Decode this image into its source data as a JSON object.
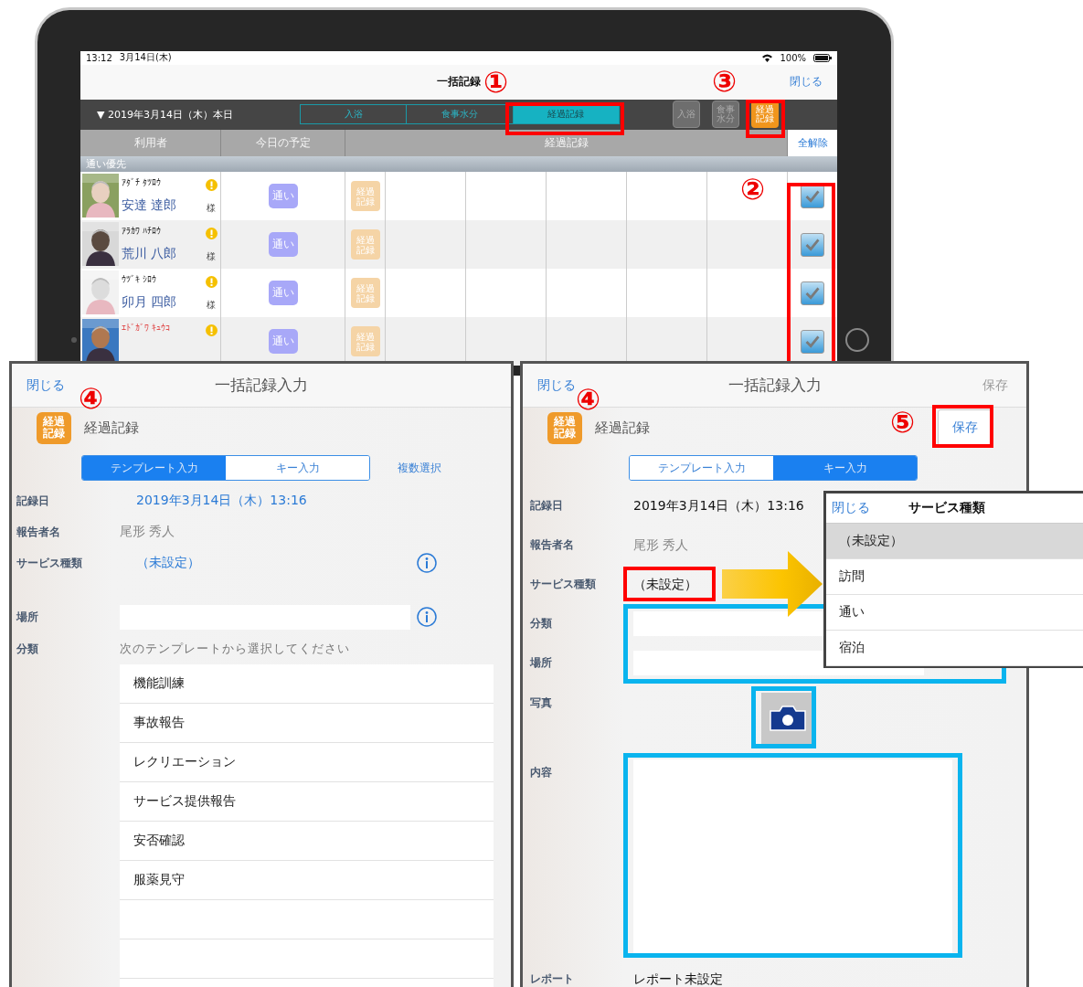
{
  "tablet": {
    "status_bar": {
      "time": "13:12",
      "date": "3月14日(木)",
      "battery": "100%"
    },
    "title": "一括記録",
    "close": "閉じる",
    "date_selector": "▼ 2019年3月14日（木）本日",
    "segments": [
      {
        "label": "入浴",
        "selected": false
      },
      {
        "label": "食事水分",
        "selected": false
      },
      {
        "label": "経過記録",
        "selected": true
      }
    ],
    "quick_buttons": [
      {
        "label": "入浴",
        "selected": false
      },
      {
        "label": "食事水分",
        "selected": false
      },
      {
        "label": "経過記録",
        "selected": true
      }
    ],
    "columns": [
      "利用者",
      "今日の予定",
      "経過記録"
    ],
    "clear_all": "全解除",
    "group": "通い優先",
    "rows": [
      {
        "kana": "ｱﾀﾞﾁ ﾀﾂﾛｳ",
        "name": "安達 達郎",
        "honorific": "様",
        "alert": true,
        "flagged": false,
        "schedule": "通い",
        "record": "経過記録",
        "checked": true
      },
      {
        "kana": "ｱﾗｶﾜ ﾊﾁﾛｳ",
        "name": "荒川 八郎",
        "honorific": "様",
        "alert": true,
        "flagged": false,
        "schedule": "通い",
        "record": "経過記録",
        "checked": true
      },
      {
        "kana": "ｳﾂﾞｷ ｼﾛｳ",
        "name": "卯月 四郎",
        "honorific": "様",
        "alert": true,
        "flagged": false,
        "schedule": "通い",
        "record": "経過記録",
        "checked": true
      },
      {
        "kana": "ｴﾄﾞｶﾞﾜ ｷｭｳｺ",
        "alert": true,
        "flagged": true,
        "schedule": "通い",
        "record": "経過記録",
        "checked": true
      }
    ]
  },
  "left_panel": {
    "close": "閉じる",
    "title": "一括記録入力",
    "section_icon": "経過記録",
    "section": "経過記録",
    "mode_tabs": [
      {
        "label": "テンプレート入力",
        "selected": true
      },
      {
        "label": "キー入力",
        "selected": false
      }
    ],
    "multi_select": "複数選択",
    "fields": [
      {
        "kind": "value",
        "label": "記録日",
        "value": "2019年3月14日（木）13:16",
        "accent": true
      },
      {
        "kind": "readonly",
        "label": "報告者名",
        "value": "尾形 秀人"
      },
      {
        "kind": "value",
        "label": "サービス種類",
        "value": "（未設定）",
        "accent": true,
        "info": true
      },
      {
        "kind": "input",
        "label": "場所",
        "info": true
      },
      {
        "kind": "hint",
        "label": "分類",
        "value": "次のテンプレートから選択してください"
      }
    ],
    "templates": [
      "機能訓練",
      "事故報告",
      "レクリエーション",
      "サービス提供報告",
      "安否確認",
      "服薬見守"
    ]
  },
  "right_panel": {
    "close": "閉じる",
    "title": "一括記録入力",
    "save_top": {
      "label": "保存",
      "disabled": true
    },
    "section_icon": "経過記録",
    "section": "経過記録",
    "save": "保存",
    "mode_tabs": [
      {
        "label": "テンプレート入力",
        "selected": false
      },
      {
        "label": "キー入力",
        "selected": true
      }
    ],
    "fields": [
      {
        "kind": "value",
        "label": "記録日",
        "value": "2019年3月14日（木）13:16",
        "accent": false
      },
      {
        "kind": "readonly",
        "label": "報告者名",
        "value": "尾形 秀人"
      },
      {
        "kind": "value",
        "label": "サービス種類",
        "value": "（未設定）",
        "accent": false
      },
      {
        "kind": "input",
        "label": "分類"
      },
      {
        "kind": "input",
        "label": "場所"
      },
      {
        "label": "写真"
      },
      {
        "kind": "textarea",
        "label": "内容"
      },
      {
        "kind": "value",
        "label": "レポート",
        "value": "レポート未設定",
        "accent": false
      }
    ]
  },
  "service_popup": {
    "close": "閉じる",
    "title": "サービス種類",
    "options": [
      {
        "label": "（未設定）",
        "selected": true
      },
      {
        "label": "訪問",
        "selected": false
      },
      {
        "label": "通い",
        "selected": false
      },
      {
        "label": "宿泊",
        "selected": false
      }
    ]
  },
  "callouts": [
    "①",
    "②",
    "③",
    "④",
    "④",
    "⑤"
  ]
}
